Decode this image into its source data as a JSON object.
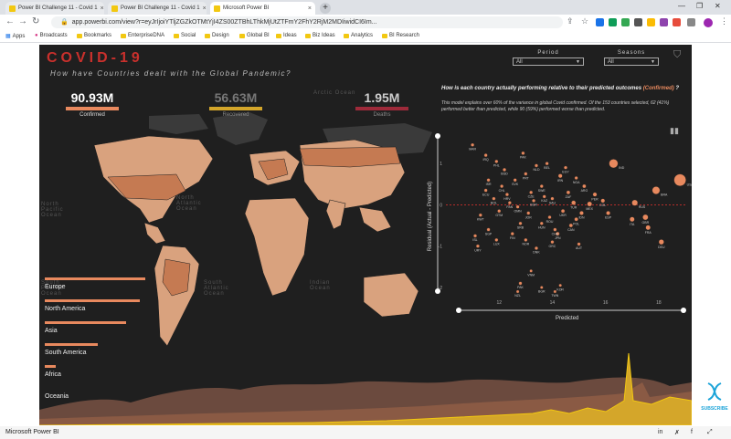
{
  "browser": {
    "tabs": [
      {
        "label": "Power BI Challenge 11 - Covid 1"
      },
      {
        "label": "Power BI Challenge 11 - Covid 1"
      },
      {
        "label": "Microsoft Power BI"
      }
    ],
    "url": "app.powerbi.com/view?r=eyJrIjoiYTljZGZkOTMtYjI4ZS00ZTBhLThkMjUtZTFmY2FhY2RjM2MDIiwidCI6Im..."
  },
  "bookmarks": [
    {
      "label": "Apps"
    },
    {
      "label": "Broadcasts"
    },
    {
      "label": "Bookmarks"
    },
    {
      "label": "EnterpriseDNA"
    },
    {
      "label": "Social"
    },
    {
      "label": "Design"
    },
    {
      "label": "Global BI"
    },
    {
      "label": "Ideas"
    },
    {
      "label": "Biz Ideas"
    },
    {
      "label": "Analytics"
    },
    {
      "label": "BI Research"
    }
  ],
  "report": {
    "title": "COVID-19",
    "subtitle": "How have Countries dealt with the Global Pandemic?",
    "kpis": [
      {
        "value": "90.93M",
        "label": "Confirmed",
        "color": "#e8895e"
      },
      {
        "value": "56.63M",
        "label": "Recovered",
        "color": "#d4a62a"
      },
      {
        "value": "1.95M",
        "label": "Deaths",
        "color": "#9e2a3a"
      }
    ],
    "slicers": [
      {
        "label": "Period",
        "value": "All"
      },
      {
        "label": "Seasons",
        "value": "All"
      }
    ],
    "map_labels": [
      "Arctic Ocean",
      "North Pacific Ocean",
      "North Atlantic Ocean",
      "South Pacific Ocean",
      "South Atlantic Ocean",
      "Indian Ocean",
      "South Atlantic Ocean"
    ],
    "regions": [
      {
        "label": "Europe",
        "share": 0.72
      },
      {
        "label": "North America",
        "share": 0.68
      },
      {
        "label": "Asia",
        "share": 0.58
      },
      {
        "label": "South America",
        "share": 0.38
      },
      {
        "label": "Africa",
        "share": 0.08
      },
      {
        "label": "Oceania",
        "share": 0.0
      }
    ],
    "scatter_question": "How is each country actually performing relative to their predicted outcomes",
    "scatter_question_hl": "(Confirmed)",
    "scatter_question_tail": "?",
    "scatter_description": "This model explains over 60% of the variance in global Covid confirmed. Of the 153 countries selected, 62 (41%) performed better than predicted, while 90 (59%) performed worse than predicted.",
    "xlabel": "Predicted",
    "ylabel": "Residual (Actual - Predicted)",
    "y_ticks": [
      "1",
      "0",
      "-1",
      "-2"
    ],
    "x_ticks": [
      "12",
      "14",
      "16",
      "18"
    ]
  },
  "status": {
    "text": "Microsoft Power BI"
  },
  "subscribe": {
    "label": "SUBSCRIBE"
  },
  "colors": {
    "accent": "#e8895e",
    "recovered": "#d4a62a",
    "deaths": "#9e2a3a",
    "title": "#c9302c"
  },
  "chart_data": {
    "type": "scatter",
    "xlabel": "Predicted",
    "ylabel": "Residual (Actual - Predicted)",
    "xlim": [
      10,
      19
    ],
    "ylim": [
      -2.2,
      1.6
    ],
    "reference_line": 0,
    "points": [
      {
        "label": "IND",
        "x": 16.3,
        "y": 1.0,
        "r": 4.8
      },
      {
        "label": "USA",
        "x": 18.8,
        "y": 0.6,
        "r": 6.5
      },
      {
        "label": "BRA",
        "x": 17.9,
        "y": 0.35,
        "r": 4.2
      },
      {
        "label": "RUS",
        "x": 17.1,
        "y": 0.05,
        "r": 3.2
      },
      {
        "label": "MEX",
        "x": 15.4,
        "y": 0.02,
        "r": 2.6
      },
      {
        "label": "GBR",
        "x": 17.5,
        "y": -0.3,
        "r": 3.0
      },
      {
        "label": "ITA",
        "x": 17.0,
        "y": -0.35,
        "r": 2.6
      },
      {
        "label": "FRA",
        "x": 17.6,
        "y": -0.55,
        "r": 2.6
      },
      {
        "label": "DEU",
        "x": 18.1,
        "y": -0.9,
        "r": 2.8
      },
      {
        "label": "ESP",
        "x": 16.1,
        "y": -0.2,
        "r": 2.2
      },
      {
        "label": "PER",
        "x": 15.6,
        "y": 0.25,
        "r": 2.2
      },
      {
        "label": "COL",
        "x": 15.9,
        "y": 0.1,
        "r": 2.2
      },
      {
        "label": "ARG",
        "x": 15.2,
        "y": 0.45,
        "r": 2.0
      },
      {
        "label": "ZAF",
        "x": 14.6,
        "y": 0.3,
        "r": 2.0
      },
      {
        "label": "IRN",
        "x": 14.3,
        "y": 0.7,
        "r": 2.2
      },
      {
        "label": "POL",
        "x": 14.9,
        "y": -0.35,
        "r": 2.0
      },
      {
        "label": "UKR",
        "x": 14.4,
        "y": -0.15,
        "r": 2.0
      },
      {
        "label": "TUR",
        "x": 14.8,
        "y": 0.05,
        "r": 2.4
      },
      {
        "label": "IDN",
        "x": 15.1,
        "y": -0.2,
        "r": 2.2
      },
      {
        "label": "CAN",
        "x": 14.7,
        "y": -0.5,
        "r": 2.0
      },
      {
        "label": "JPN",
        "x": 14.2,
        "y": -0.7,
        "r": 2.0
      },
      {
        "label": "AUT",
        "x": 15.0,
        "y": -0.95,
        "r": 1.8
      },
      {
        "label": "CHE",
        "x": 14.1,
        "y": -0.6,
        "r": 1.8
      },
      {
        "label": "HUN",
        "x": 13.6,
        "y": -0.45,
        "r": 1.8
      },
      {
        "label": "ROU",
        "x": 13.9,
        "y": -0.3,
        "r": 1.8
      },
      {
        "label": "SWE",
        "x": 13.6,
        "y": 0.45,
        "r": 1.8
      },
      {
        "label": "CZE",
        "x": 13.2,
        "y": 0.3,
        "r": 1.8
      },
      {
        "label": "NLD",
        "x": 13.4,
        "y": 0.95,
        "r": 1.8
      },
      {
        "label": "BEL",
        "x": 13.8,
        "y": 1.0,
        "r": 1.8
      },
      {
        "label": "PRT",
        "x": 13.0,
        "y": 0.75,
        "r": 1.8
      },
      {
        "label": "PAK",
        "x": 12.9,
        "y": 1.25,
        "r": 1.8
      },
      {
        "label": "BGD",
        "x": 12.2,
        "y": 0.85,
        "r": 1.8
      },
      {
        "label": "PHL",
        "x": 11.9,
        "y": 1.05,
        "r": 1.8
      },
      {
        "label": "IRQ",
        "x": 11.5,
        "y": 1.2,
        "r": 1.8
      },
      {
        "label": "MAR",
        "x": 11.0,
        "y": 1.45,
        "r": 1.8
      },
      {
        "label": "ISR",
        "x": 11.6,
        "y": 0.6,
        "r": 1.8
      },
      {
        "label": "CHL",
        "x": 12.1,
        "y": 0.45,
        "r": 1.8
      },
      {
        "label": "ECU",
        "x": 11.5,
        "y": 0.35,
        "r": 1.8
      },
      {
        "label": "BOL",
        "x": 11.8,
        "y": 0.15,
        "r": 1.8
      },
      {
        "label": "PAN",
        "x": 12.4,
        "y": 0.05,
        "r": 1.8
      },
      {
        "label": "GTM",
        "x": 12.0,
        "y": -0.15,
        "r": 1.8
      },
      {
        "label": "KWT",
        "x": 11.3,
        "y": -0.25,
        "r": 1.8
      },
      {
        "label": "OMN",
        "x": 12.7,
        "y": -0.05,
        "r": 1.8
      },
      {
        "label": "JOR",
        "x": 13.1,
        "y": -0.2,
        "r": 1.8
      },
      {
        "label": "SRB",
        "x": 12.8,
        "y": -0.45,
        "r": 1.8
      },
      {
        "label": "SGP",
        "x": 11.6,
        "y": -0.6,
        "r": 1.8
      },
      {
        "label": "LUX",
        "x": 11.9,
        "y": -0.85,
        "r": 1.8
      },
      {
        "label": "ISL",
        "x": 11.1,
        "y": -0.75,
        "r": 1.8
      },
      {
        "label": "URY",
        "x": 11.2,
        "y": -1.0,
        "r": 1.8
      },
      {
        "label": "NOR",
        "x": 13.0,
        "y": -0.85,
        "r": 1.8
      },
      {
        "label": "FIN",
        "x": 12.5,
        "y": -0.7,
        "r": 1.8
      },
      {
        "label": "DNK",
        "x": 13.4,
        "y": -1.05,
        "r": 1.8
      },
      {
        "label": "GRC",
        "x": 14.0,
        "y": -0.9,
        "r": 1.8
      },
      {
        "label": "SVK",
        "x": 12.6,
        "y": 0.6,
        "r": 1.8
      },
      {
        "label": "HRV",
        "x": 12.3,
        "y": 0.25,
        "r": 1.8
      },
      {
        "label": "BGR",
        "x": 13.3,
        "y": 0.1,
        "r": 1.8
      },
      {
        "label": "KAZ",
        "x": 13.7,
        "y": 0.2,
        "r": 1.8
      },
      {
        "label": "SAU",
        "x": 14.0,
        "y": 0.15,
        "r": 1.8
      },
      {
        "label": "EGY",
        "x": 14.5,
        "y": 0.9,
        "r": 1.8
      },
      {
        "label": "NGA",
        "x": 14.9,
        "y": 0.65,
        "r": 1.8
      },
      {
        "label": "PAK",
        "x": 12.8,
        "y": -1.9,
        "r": 1.8
      },
      {
        "label": "BGR",
        "x": 13.6,
        "y": -2.0,
        "r": 1.6
      },
      {
        "label": "KOR",
        "x": 14.3,
        "y": -1.95,
        "r": 1.6
      },
      {
        "label": "TWN",
        "x": 14.1,
        "y": -2.1,
        "r": 1.6
      },
      {
        "label": "NZL",
        "x": 12.7,
        "y": -2.1,
        "r": 1.6
      },
      {
        "label": "VNM",
        "x": 13.2,
        "y": -1.6,
        "r": 1.6
      }
    ]
  }
}
